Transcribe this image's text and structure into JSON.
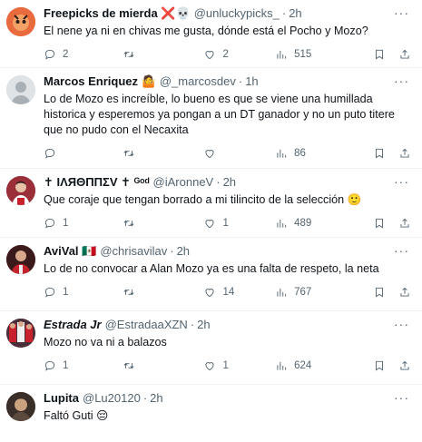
{
  "tweets": [
    {
      "name": "Freepicks de mierda ❌💀",
      "handle": "@unluckypicks_",
      "time": "2h",
      "text": "El nene ya ni en chivas me gusta, dónde está el Pocho y Mozo?",
      "replies": "2",
      "retweets": "",
      "likes": "2",
      "views": "515",
      "avatar_color": "#d9573a"
    },
    {
      "name": "Marcos Enriquez 🤷",
      "handle": "@_marcosdev",
      "time": "1h",
      "text": "Lo de Mozo es increíble, lo bueno es que se viene una humillada historica y esperemos ya pongan a un DT ganador y no un puto titere que no pudo con el Necaxita",
      "replies": "",
      "retweets": "",
      "likes": "",
      "views": "86",
      "avatar_color": "#cfd3d6"
    },
    {
      "name": "✝ IΛЯΘΠΠΣV ✝ ᴳᵒᵈ",
      "handle": "@iAronneV",
      "time": "2h",
      "text": "Que coraje que tengan borrado a mi tilincito de la selección 🙂",
      "replies": "1",
      "retweets": "",
      "likes": "1",
      "views": "489",
      "avatar_color": "#8a3b3f"
    },
    {
      "name": "AviVal 🇲🇽",
      "handle": "@chrisavilav",
      "time": "2h",
      "text": "Lo de no convocar a Alan Mozo ya es una falta de respeto, la neta",
      "replies": "1",
      "retweets": "",
      "likes": "14",
      "views": "767",
      "avatar_color": "#b8262b"
    },
    {
      "name": "Estrada Jr",
      "handle": "@EstradaaXZN",
      "time": "2h",
      "text": "Mozo no va ni a balazos",
      "replies": "1",
      "retweets": "",
      "likes": "1",
      "views": "624",
      "avatar_color": "#7d4a5a"
    },
    {
      "name": "Lupita",
      "handle": "@Lu20120",
      "time": "2h",
      "text": "Faltó Guti 😔",
      "replies": "",
      "retweets": "",
      "likes": "",
      "views": "",
      "avatar_color": "#6f5644"
    }
  ]
}
